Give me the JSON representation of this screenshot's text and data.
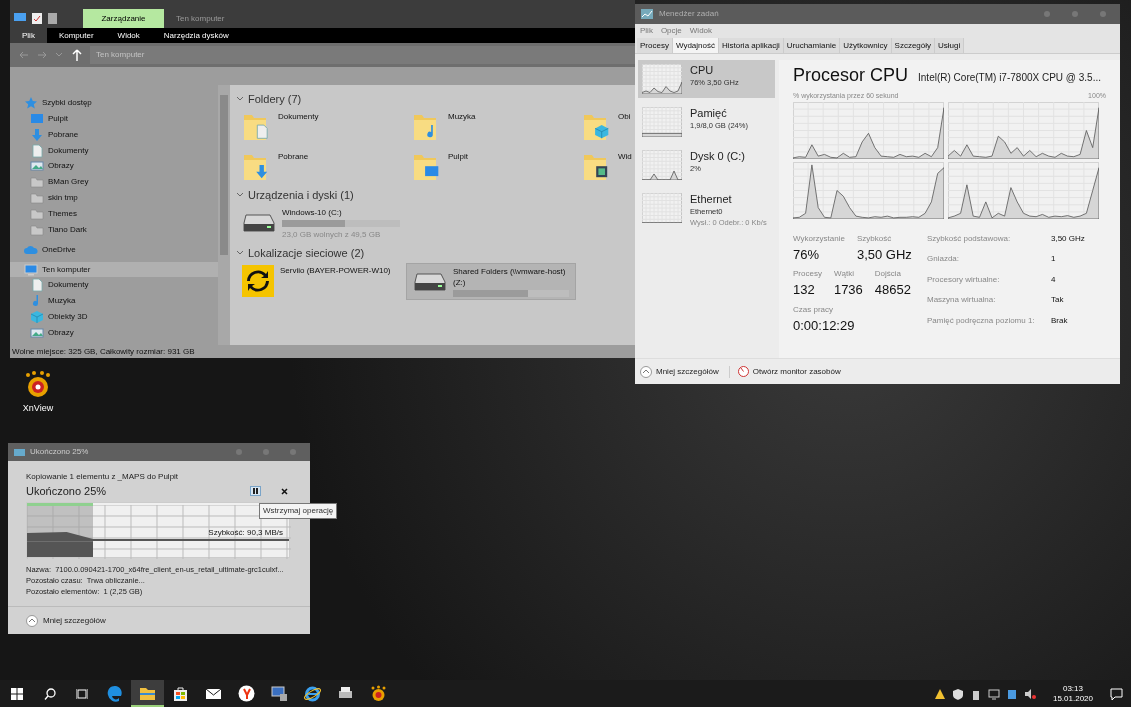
{
  "desktop": {
    "icons": [
      {
        "label": "XnView"
      }
    ]
  },
  "explorer": {
    "title": "Ten komputer",
    "context_tab": "Zarządzanie",
    "ribbon_tabs": [
      {
        "label": "Plik",
        "selected": true
      },
      {
        "label": "Komputer",
        "selected": false
      },
      {
        "label": "Widok",
        "selected": false
      },
      {
        "label": "Narzędzia dysków",
        "selected": false
      }
    ],
    "address": "Ten komputer",
    "nav": [
      {
        "label": "Szybki dostęp",
        "kind": "star",
        "selected": false,
        "children": [
          {
            "label": "Pulpit",
            "kind": "desktop",
            "selected": false
          },
          {
            "label": "Pobrane",
            "kind": "download",
            "selected": false
          },
          {
            "label": "Dokumenty",
            "kind": "document",
            "selected": false
          },
          {
            "label": "Obrazy",
            "kind": "picture",
            "selected": false
          },
          {
            "label": "BMan Grey",
            "kind": "folder",
            "selected": false
          },
          {
            "label": "skin tmp",
            "kind": "folder",
            "selected": false
          },
          {
            "label": "Themes",
            "kind": "folder",
            "selected": false
          },
          {
            "label": "Tiano Dark",
            "kind": "folder",
            "selected": false
          }
        ]
      },
      {
        "label": "OneDrive",
        "kind": "cloud",
        "selected": false
      },
      {
        "label": "Ten komputer",
        "kind": "computer",
        "selected": true,
        "children": [
          {
            "label": "Dokumenty",
            "kind": "document",
            "selected": false
          },
          {
            "label": "Muzyka",
            "kind": "music",
            "selected": false
          },
          {
            "label": "Obiekty 3D",
            "kind": "cube",
            "selected": false
          },
          {
            "label": "Obrazy",
            "kind": "picture",
            "selected": false
          }
        ]
      }
    ],
    "sections": [
      {
        "title": "Foldery (7)",
        "expanded": true,
        "items": [
          {
            "kind": "document",
            "label": "Dokumenty",
            "selected": false
          },
          {
            "kind": "music",
            "label": "Muzyka",
            "selected": false
          },
          {
            "kind": "cube",
            "label": "Obi",
            "selected": false
          },
          {
            "kind": "download",
            "label": "Pobrane",
            "selected": false
          },
          {
            "kind": "desktop",
            "label": "Pulpit",
            "selected": false
          },
          {
            "kind": "video",
            "label": "Wid",
            "selected": false
          }
        ]
      },
      {
        "title": "Urządzenia i dyski (1)",
        "expanded": true,
        "items": [
          {
            "kind": "drive",
            "label": "Windows-10 (C:)",
            "level": 0.53,
            "detail": "23,0 GB wolnych z 49,5 GB",
            "selected": false
          }
        ]
      },
      {
        "title": "Lokalizacje sieciowe (2)",
        "expanded": true,
        "items": [
          {
            "kind": "network",
            "label": "Serviio (BAYER-POWER-W10)",
            "selected": false
          },
          {
            "kind": "drive",
            "label": "Shared Folders (\\\\vmware-host) (Z:)",
            "level": 0.65,
            "selected": true
          }
        ]
      }
    ],
    "status": "Wolne miejsce: 325 GB, Całkowity rozmiar: 931 GB"
  },
  "task_manager": {
    "title": "Menedżer zadań",
    "menu": [
      "Plik",
      "Opcje",
      "Widok"
    ],
    "tabs": [
      {
        "label": "Procesy",
        "selected": false
      },
      {
        "label": "Wydajność",
        "selected": true
      },
      {
        "label": "Historia aplikacji",
        "selected": false
      },
      {
        "label": "Uruchamianie",
        "selected": false
      },
      {
        "label": "Użytkownicy",
        "selected": false
      },
      {
        "label": "Szczegóły",
        "selected": false
      },
      {
        "label": "Usługi",
        "selected": false
      }
    ],
    "resources": [
      {
        "name": "CPU",
        "detail": "76% 3,50 GHz",
        "selected": true
      },
      {
        "name": "Pamięć",
        "detail": "1,9/8,0 GB (24%)",
        "selected": false
      },
      {
        "name": "Dysk 0 (C:)",
        "detail": "2%",
        "selected": false
      },
      {
        "name": "Ethernet",
        "detail": "Ethernet0",
        "detail2": "Wysł.: 0 Odebr.: 0 Kb/s",
        "selected": false
      }
    ],
    "heading": "Procesor CPU",
    "model": "Intel(R) Core(TM) i7-7800X CPU @ 3.5...",
    "graph_caption": "% wykorzystania przez 60 sekund",
    "graph_max": "100%",
    "stats": [
      [
        {
          "label": "Wykorzystanie",
          "value": "76%"
        },
        {
          "label": "Szybkość",
          "value": "3,50 GHz"
        }
      ],
      [
        {
          "label": "Procesy",
          "value": "132"
        },
        {
          "label": "Wątki",
          "value": "1736"
        },
        {
          "label": "Dojścia",
          "value": "48652"
        }
      ],
      [
        {
          "label": "Czas pracy",
          "value": "0:00:12:29"
        }
      ]
    ],
    "specs": [
      {
        "label": "Szybkość podstawowa:",
        "value": "3,50 GHz"
      },
      {
        "label": "Gniazda:",
        "value": "1"
      },
      {
        "label": "Procesory wirtualne:",
        "value": "4"
      },
      {
        "label": "Maszyna wirtualna:",
        "value": "Tak"
      },
      {
        "label": "Pamięć podręczna poziomu 1:",
        "value": "Brak"
      }
    ],
    "footer": [
      "Mniej szczegółów",
      "Otwórz monitor zasobów"
    ]
  },
  "copy_dialog": {
    "title": "Ukończono 25%",
    "description": "Kopiowanie 1 elementu z _MAPS do Pulpit",
    "heading": "Ukończono 25%",
    "level": 0.25,
    "tooltip": "Wstrzymaj operację",
    "speed": "Szybkość: 90,3 MB/s",
    "details": [
      "Nazwa:  7100.0.090421-1700_x64fre_client_en-us_retail_ultimate-grc1culxf...",
      "Pozostało czasu:  Trwa obliczanie...",
      "Pozostało elementów:  1 (2,25 GB)"
    ],
    "footer": "Mniej szczegółów"
  },
  "taskbar": {
    "apps": [
      {
        "kind": "edge",
        "active": false
      },
      {
        "kind": "explorer",
        "active": true
      },
      {
        "kind": "store",
        "active": false
      },
      {
        "kind": "mail",
        "active": false
      },
      {
        "kind": "yandex",
        "active": false
      },
      {
        "kind": "network-pc",
        "active": false
      },
      {
        "kind": "ie",
        "active": false
      },
      {
        "kind": "printer",
        "active": false
      },
      {
        "kind": "xnview",
        "active": false
      }
    ],
    "time": "03:13",
    "date": "15.01.2020"
  }
}
